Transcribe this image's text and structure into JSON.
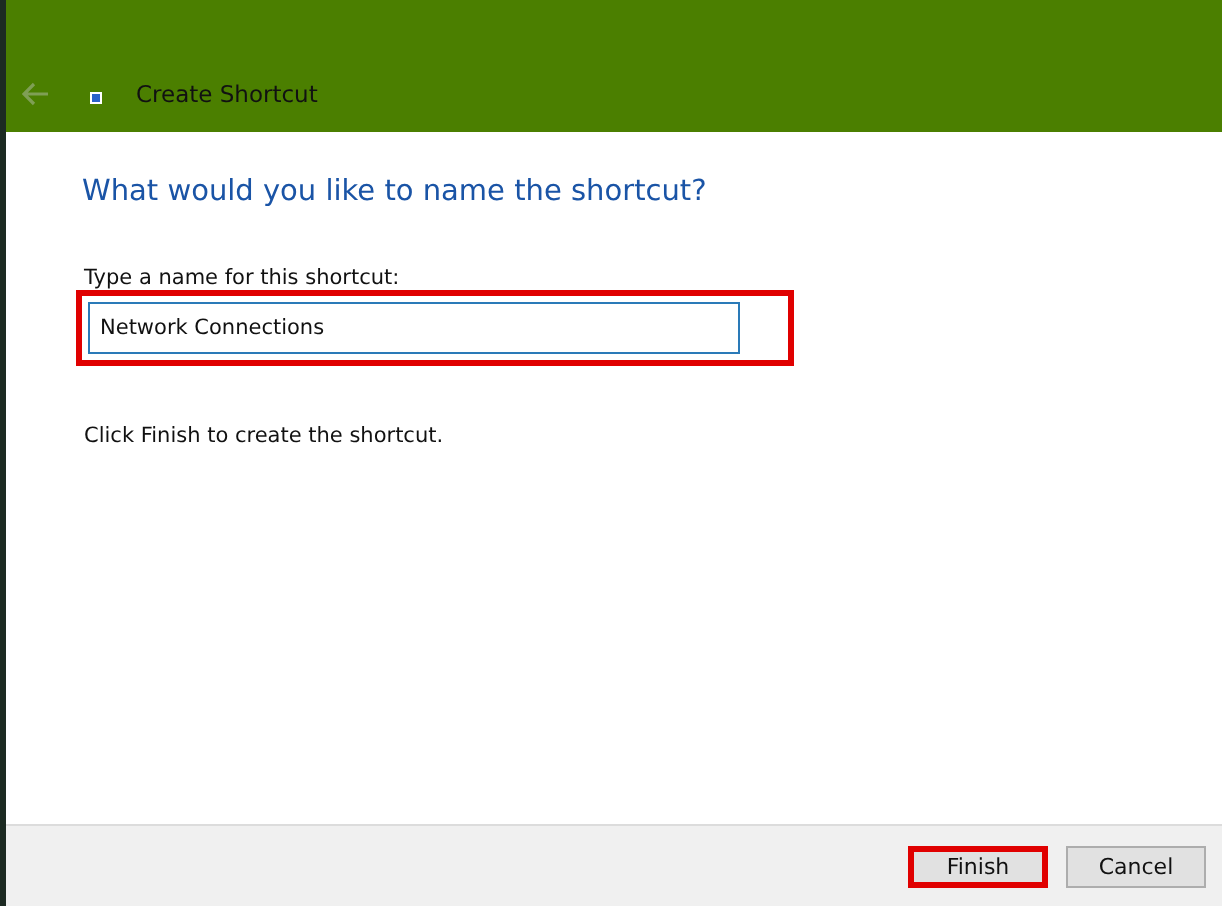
{
  "window": {
    "title": "Create Shortcut",
    "back_disabled": true
  },
  "heading": "What would you like to name the shortcut?",
  "name_field": {
    "label": "Type a name for this shortcut:",
    "value": "Network Connections",
    "highlighted": true
  },
  "hint": "Click Finish to create the shortcut.",
  "buttons": [
    {
      "label": "Finish",
      "highlighted": true
    },
    {
      "label": "Cancel",
      "highlighted": false
    }
  ]
}
